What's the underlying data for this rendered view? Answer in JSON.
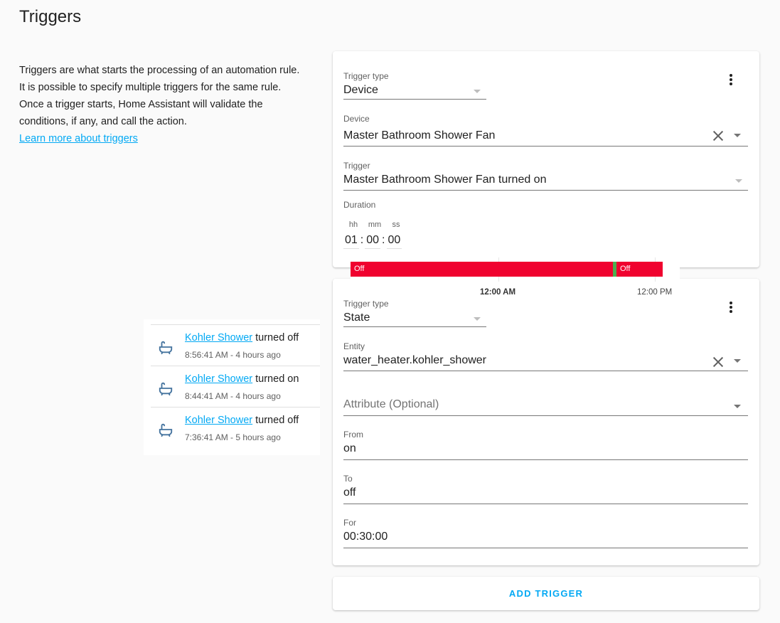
{
  "page": {
    "title": "Triggers",
    "intro": "Triggers are what starts the processing of an automation rule. It is possible to specify multiple triggers for the same rule. Once a trigger starts, Home Assistant will validate the conditions, if any, and call the action.",
    "learn_more": "Learn more about triggers"
  },
  "trigger1": {
    "type_label": "Trigger type",
    "type_value": "Device",
    "device_label": "Device",
    "device_value": "Master Bathroom Shower Fan",
    "trigger_label": "Trigger",
    "trigger_value": "Master Bathroom Shower Fan turned on",
    "duration_label": "Duration",
    "duration": {
      "hh_label": "hh",
      "mm_label": "mm",
      "ss_label": "ss",
      "hh": "01",
      "mm": "00",
      "ss": "00",
      "sep": ":"
    }
  },
  "history_popup": {
    "segments": [
      {
        "label": "Off",
        "color": "#f0022f"
      },
      {
        "label": "",
        "color": "#4caf50"
      },
      {
        "label": "Off",
        "color": "#f0022f"
      }
    ],
    "ticks": [
      "12:00 AM",
      "12:00 PM"
    ]
  },
  "trigger2": {
    "type_label": "Trigger type",
    "type_value": "State",
    "entity_label": "Entity",
    "entity_value": "water_heater.kohler_shower",
    "attribute_placeholder": "Attribute (Optional)",
    "from_label": "From",
    "from_value": "on",
    "to_label": "To",
    "to_value": "off",
    "for_label": "For",
    "for_value": "00:30:00"
  },
  "logbook": [
    {
      "entity": "Kohler Shower",
      "action": " turned off",
      "time": "8:56:41 AM - 4 hours ago",
      "icon": "bathtub-icon"
    },
    {
      "entity": "Kohler Shower",
      "action": " turned on",
      "time": "8:44:41 AM - 4 hours ago",
      "icon": "bathtub-icon"
    },
    {
      "entity": "Kohler Shower",
      "action": " turned off",
      "time": "7:36:41 AM - 5 hours ago",
      "icon": "bathtub-icon"
    }
  ],
  "add_trigger": "ADD TRIGGER",
  "colors": {
    "accent": "#03a9f4",
    "off": "#f0022f",
    "on": "#4caf50"
  }
}
